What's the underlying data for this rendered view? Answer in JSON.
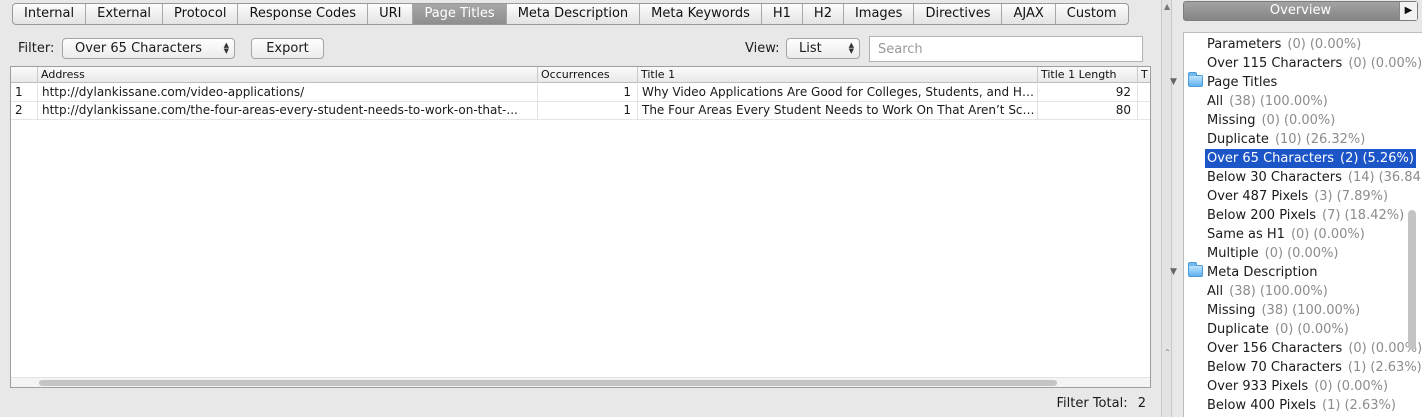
{
  "tabs": [
    "Internal",
    "External",
    "Protocol",
    "Response Codes",
    "URI",
    "Page Titles",
    "Meta Description",
    "Meta Keywords",
    "H1",
    "H2",
    "Images",
    "Directives",
    "AJAX",
    "Custom"
  ],
  "active_tab": "Page Titles",
  "filter": {
    "label": "Filter:",
    "selected": "Over 65 Characters",
    "export_label": "Export"
  },
  "view": {
    "label": "View:",
    "selected": "List"
  },
  "search": {
    "placeholder": "Search"
  },
  "table": {
    "columns": [
      "Address",
      "Occurrences",
      "Title 1",
      "Title 1 Length",
      "T"
    ],
    "rows": [
      {
        "index": "1",
        "address": "http://dylankissane.com/video-applications/",
        "occurrences": "1",
        "title": "Why Video Applications Are Good for Colleges, Students, and Hig...",
        "length": "92"
      },
      {
        "index": "2",
        "address": "http://dylankissane.com/the-four-areas-every-student-needs-to-work-on-that-...",
        "occurrences": "1",
        "title": "The Four Areas Every Student Needs to Work On That Aren’t Scho...",
        "length": "80"
      }
    ]
  },
  "filter_total": {
    "label": "Filter Total:",
    "value": "2"
  },
  "overview": {
    "title": "Overview",
    "items": [
      {
        "label": "Parameters",
        "count": "(0)",
        "pct": "(0.00%)",
        "type": "child"
      },
      {
        "label": "Over 115 Characters",
        "count": "(0)",
        "pct": "(0.00%)",
        "type": "child"
      },
      {
        "label": "Page Titles",
        "type": "folder"
      },
      {
        "label": "All",
        "count": "(38)",
        "pct": "(100.00%)",
        "type": "child"
      },
      {
        "label": "Missing",
        "count": "(0)",
        "pct": "(0.00%)",
        "type": "child"
      },
      {
        "label": "Duplicate",
        "count": "(10)",
        "pct": "(26.32%)",
        "type": "child"
      },
      {
        "label": "Over 65 Characters",
        "count": "(2)",
        "pct": "(5.26%)",
        "type": "child",
        "selected": true
      },
      {
        "label": "Below 30 Characters",
        "count": "(14)",
        "pct": "(36.84",
        "type": "child"
      },
      {
        "label": "Over 487 Pixels",
        "count": "(3)",
        "pct": "(7.89%)",
        "type": "child"
      },
      {
        "label": "Below 200 Pixels",
        "count": "(7)",
        "pct": "(18.42%)",
        "type": "child"
      },
      {
        "label": "Same as H1",
        "count": "(0)",
        "pct": "(0.00%)",
        "type": "child"
      },
      {
        "label": "Multiple",
        "count": "(0)",
        "pct": "(0.00%)",
        "type": "child"
      },
      {
        "label": "Meta Description",
        "type": "folder"
      },
      {
        "label": "All",
        "count": "(38)",
        "pct": "(100.00%)",
        "type": "child"
      },
      {
        "label": "Missing",
        "count": "(38)",
        "pct": "(100.00%)",
        "type": "child"
      },
      {
        "label": "Duplicate",
        "count": "(0)",
        "pct": "(0.00%)",
        "type": "child"
      },
      {
        "label": "Over 156 Characters",
        "count": "(0)",
        "pct": "(0.00%)",
        "type": "child"
      },
      {
        "label": "Below 70 Characters",
        "count": "(1)",
        "pct": "(2.63%)",
        "type": "child"
      },
      {
        "label": "Over 933 Pixels",
        "count": "(0)",
        "pct": "(0.00%)",
        "type": "child"
      },
      {
        "label": "Below 400 Pixels",
        "count": "(1)",
        "pct": "(2.63%)",
        "type": "child"
      }
    ]
  },
  "colors": {
    "selection": "#1c55c7",
    "active_tab": "#9a9a9a",
    "folder": "#5eb2ef"
  },
  "icons": {
    "folder": "folder-icon",
    "expand": "triangle-right-icon",
    "disclosure": "triangle-down-icon"
  }
}
